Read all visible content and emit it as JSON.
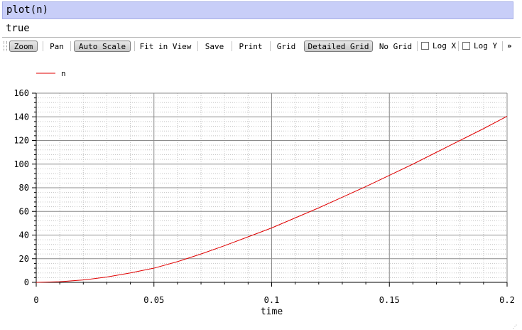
{
  "command": {
    "text": "plot(n)"
  },
  "result": {
    "text": "true"
  },
  "toolbar": {
    "zoom": "Zoom",
    "pan": "Pan",
    "auto_scale": "Auto Scale",
    "fit_in_view": "Fit in View",
    "save": "Save",
    "print": "Print",
    "grid": "Grid",
    "detailed_grid": "Detailed Grid",
    "no_grid": "No Grid",
    "log_x": "Log X",
    "log_y": "Log Y",
    "more": "»"
  },
  "colors": {
    "series": "#e00000",
    "command_bg": "#c8cef8"
  },
  "chart_data": {
    "type": "line",
    "xlabel": "time",
    "ylabel": "",
    "xlim": [
      0,
      0.2
    ],
    "ylim": [
      0,
      160
    ],
    "xticks": [
      0,
      0.05,
      0.1,
      0.15,
      0.2
    ],
    "yticks": [
      0,
      20,
      40,
      60,
      80,
      100,
      120,
      140,
      160
    ],
    "grid": "detailed",
    "legend": "top-left",
    "series": [
      {
        "name": "n",
        "x": [
          0,
          0.01,
          0.02,
          0.03,
          0.04,
          0.05,
          0.06,
          0.07,
          0.08,
          0.09,
          0.1,
          0.11,
          0.12,
          0.13,
          0.14,
          0.15,
          0.16,
          0.17,
          0.18,
          0.19,
          0.2
        ],
        "y": [
          0,
          0.5,
          2,
          4.5,
          8,
          12,
          17.5,
          24,
          31,
          38.5,
          46,
          54.5,
          63,
          72,
          81,
          90.5,
          100,
          110,
          120,
          130,
          140.5
        ]
      }
    ]
  }
}
